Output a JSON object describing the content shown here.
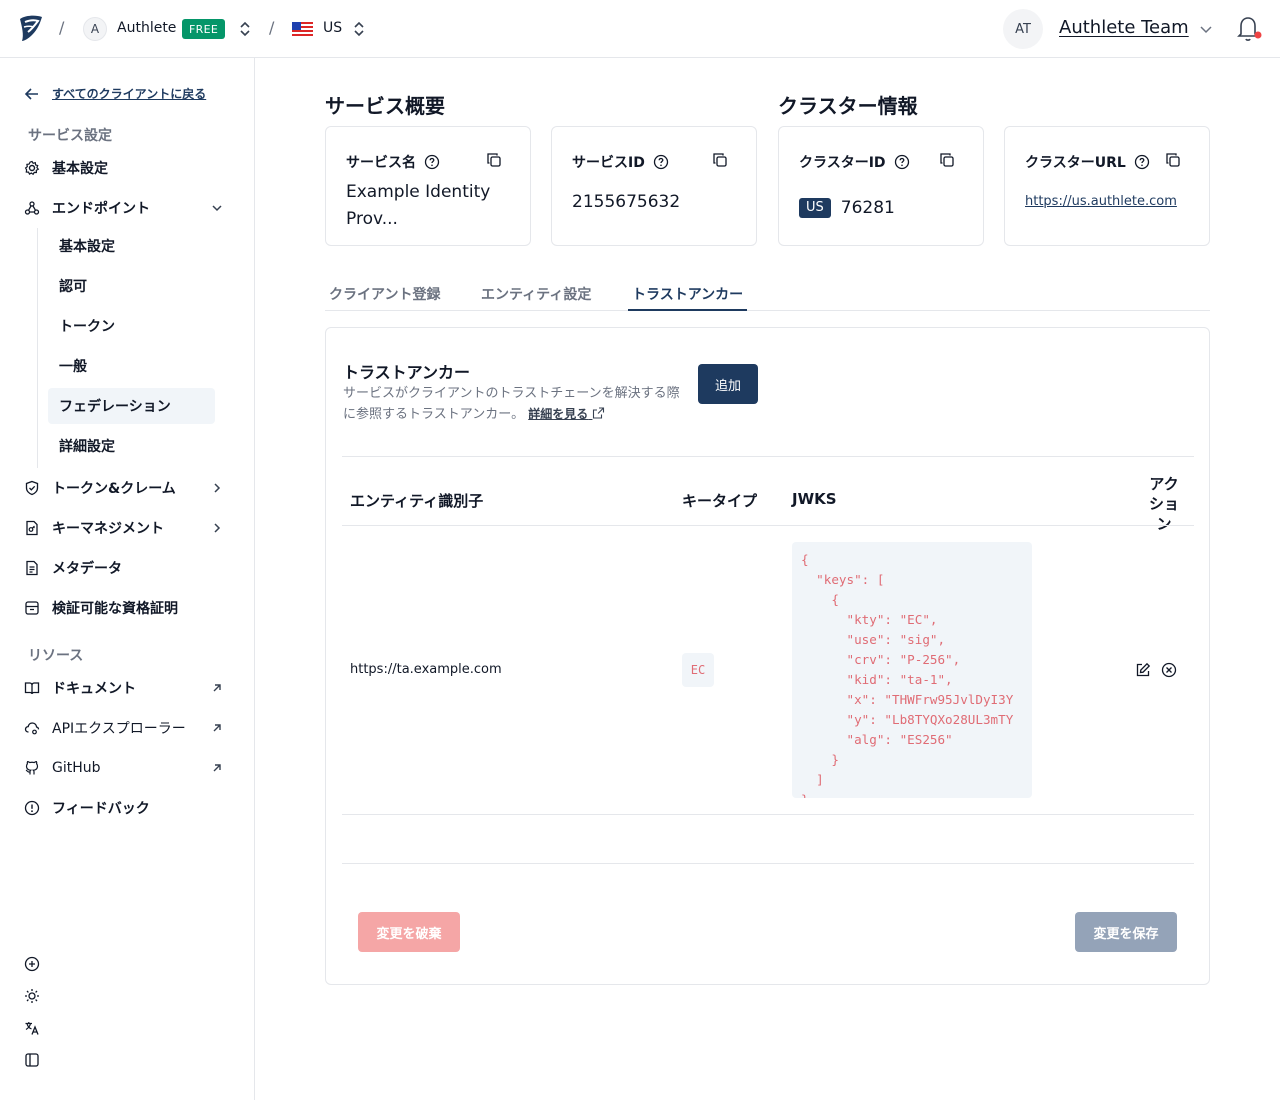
{
  "header": {
    "sep1": "/",
    "sep2": "/",
    "org_initial": "A",
    "org_name": "Authlete",
    "plan_badge": "FREE",
    "region": "US",
    "user_initials": "AT",
    "user_name": "Authlete Team"
  },
  "sidebar": {
    "back_label": "すべてのクライアントに戻る",
    "section_service": "サービス設定",
    "items": {
      "basic": "基本設定",
      "endpoints": "エンドポイント",
      "tokens_claims": "トークン&クレーム",
      "key_mgmt": "キーマネジメント",
      "metadata": "メタデータ",
      "vc": "検証可能な資格証明"
    },
    "sub_items": [
      "基本設定",
      "認可",
      "トークン",
      "一般",
      "フェデレーション",
      "詳細設定"
    ],
    "active_sub": "フェデレーション",
    "section_resources": "リソース",
    "resources": [
      "ドキュメント",
      "APIエクスプローラー",
      "GitHub",
      "フィードバック"
    ]
  },
  "overview": {
    "service_heading": "サービス概要",
    "cluster_heading": "クラスター情報",
    "cards": [
      {
        "title": "サービス名",
        "value": "Example Identity Prov..."
      },
      {
        "title": "サービスID",
        "value": "2155675632"
      },
      {
        "title": "クラスターID",
        "badge": "US",
        "value": "76281"
      },
      {
        "title": "クラスターURL",
        "value": "https://us.authlete.com"
      }
    ]
  },
  "tabs": [
    "クライアント登録",
    "エンティティ設定",
    "トラストアンカー"
  ],
  "active_tab": "トラストアンカー",
  "panel": {
    "title": "トラストアンカー",
    "description": "サービスがクライアントのトラストチェーンを解決する際に参照するトラストアンカー。",
    "more_link": "詳細を見る",
    "add_button": "追加",
    "columns": [
      "エンティティ識別子",
      "キータイプ",
      "JWKS",
      "アクション"
    ],
    "rows": [
      {
        "entity": "https://ta.example.com",
        "key_type": "EC",
        "jwks": "{\n  \"keys\": [\n    {\n      \"kty\": \"EC\",\n      \"use\": \"sig\",\n      \"crv\": \"P-256\",\n      \"kid\": \"ta-1\",\n      \"x\": \"THWFrw95JvlDyI3Y\n      \"y\": \"Lb8TYQXo28UL3mTY\n      \"alg\": \"ES256\"\n    }\n  ]\n}"
      }
    ],
    "discard_button": "変更を破棄",
    "save_button": "変更を保存"
  },
  "colors": {
    "primary": "#1e3a5f",
    "free_badge": "#059669",
    "discard": "#f5a6a6",
    "save_disabled": "#94a3b8",
    "notification_dot": "#ef4444"
  }
}
